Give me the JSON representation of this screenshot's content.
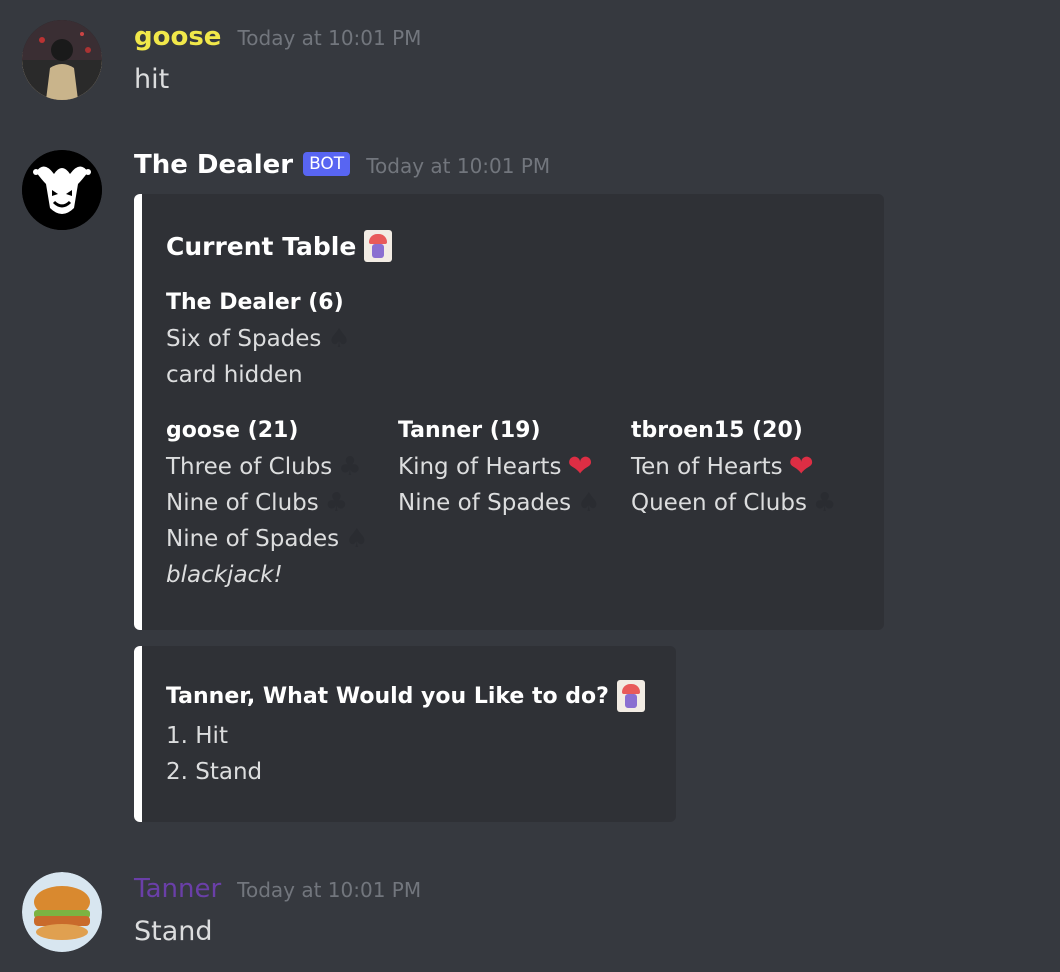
{
  "messages": [
    {
      "user": "goose",
      "user_color": "#f1e84a",
      "timestamp": "Today at 10:01 PM",
      "text": "hit"
    },
    {
      "user": "The Dealer",
      "badge": "BOT",
      "timestamp": "Today at 10:01 PM"
    },
    {
      "user": "Tanner",
      "user_color": "#6a3fa8",
      "timestamp": "Today at 10:01 PM",
      "text": "Stand"
    }
  ],
  "embed1": {
    "title": "Current Table",
    "dealer": {
      "name": "The Dealer (6)",
      "lines": [
        "Six of Spades",
        "card hidden"
      ]
    },
    "players": [
      {
        "name": "goose (21)",
        "cards": [
          "Three of Clubs",
          "Nine of Clubs",
          "Nine of Spades"
        ],
        "note": "blackjack!"
      },
      {
        "name": "Tanner (19)",
        "cards": [
          "King of Hearts",
          "Nine of Spades"
        ]
      },
      {
        "name": "tbroen15 (20)",
        "cards": [
          "Ten of Hearts",
          "Queen of Clubs"
        ]
      }
    ]
  },
  "embed2": {
    "title": "Tanner, What Would you Like to do?",
    "options": [
      "1. Hit",
      "2. Stand"
    ]
  },
  "icons": {
    "spade": "♠",
    "club": "♣",
    "heart": "❤"
  }
}
